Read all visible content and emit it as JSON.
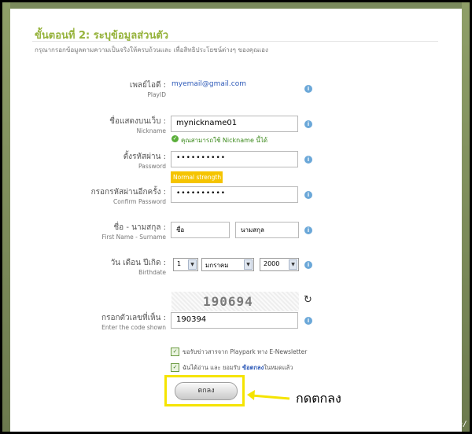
{
  "header": {
    "title": "ขั้นตอนที่ 2: ระบุข้อมูลส่วนตัว",
    "subtitle": "กรุณากรอกข้อมูลตามความเป็นจริงให้ครบถ้วนและ เพื่อสิทธิประโยชน์ต่างๆ ของคุณเอง"
  },
  "form": {
    "playid": {
      "label_th": "เพลย์ไอดี :",
      "label_en": "PlayID",
      "value": "myemail@gmail.com"
    },
    "nickname": {
      "label_th": "ชื่อแสดงบนเว็บ :",
      "label_en": "Nickname",
      "value": "mynickname01",
      "status": "คุณสามารถใช้ Nickname นี้ได้"
    },
    "password": {
      "label_th": "ตั้งรหัสผ่าน :",
      "label_en": "Password",
      "value": "••••••••••",
      "strength": "Normal strength"
    },
    "confirm": {
      "label_th": "กรอกรหัสผ่านอีกครั้ง :",
      "label_en": "Confirm Password",
      "value": "••••••••••"
    },
    "name": {
      "label_th": "ชื่อ - นามสกุล :",
      "label_en": "First Name - Surname",
      "first": "ชื่อ",
      "last": "นามสกุล"
    },
    "birthdate": {
      "label_th": "วัน เดือน ปีเกิด :",
      "label_en": "Birthdate",
      "day": "1",
      "month": "มกราคม",
      "year": "2000"
    },
    "captcha": {
      "label_th": "กรอกตัวเลขที่เห็น :",
      "label_en": "Enter the code shown",
      "image_code": "190694",
      "value": "190394"
    },
    "newsletter": "ขอรับข่าวสารจาก Playpark ทาง E-Newsletter",
    "terms_prefix": "ฉันได้อ่าน และ ยอมรับ ",
    "terms_link": "ข้อตกลง",
    "terms_suffix": "ในหมดแล้ว",
    "submit_label": "ตกลง"
  },
  "annotation": {
    "text": "กดตกลง",
    "color": "#f5e400"
  },
  "watermark": "[929x826] https://upic.me/",
  "colors": {
    "title": "#95b23a",
    "strength_badge": "#f5c400",
    "link": "#2e5ab8",
    "check": "#6a9a40"
  }
}
